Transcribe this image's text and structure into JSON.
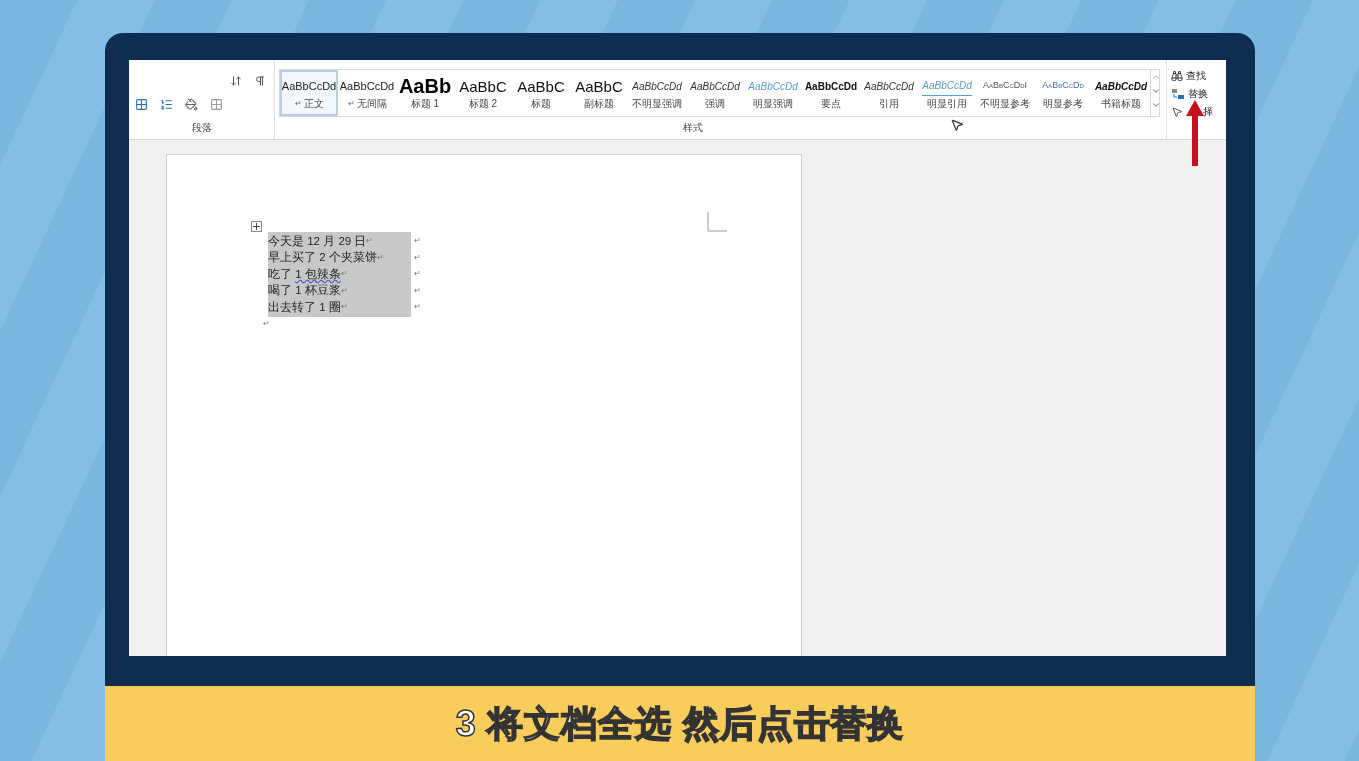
{
  "ribbon": {
    "paragraph_group": {
      "label": "段落"
    },
    "styles_group": {
      "label": "样式",
      "styles": [
        {
          "preview": "AaBbCcDd",
          "label": "正文",
          "kind": "normal",
          "mark": "↵",
          "selected": true
        },
        {
          "preview": "AaBbCcDd",
          "label": "无间隔",
          "kind": "normal",
          "mark": "↵",
          "selected": false
        },
        {
          "preview": "AaBb",
          "label": "标题 1",
          "kind": "heading-large",
          "selected": false
        },
        {
          "preview": "AaBbC",
          "label": "标题 2",
          "kind": "heading",
          "selected": false
        },
        {
          "preview": "AaBbC",
          "label": "标题",
          "kind": "heading",
          "selected": false
        },
        {
          "preview": "AaBbC",
          "label": "副标题",
          "kind": "heading",
          "selected": false
        },
        {
          "preview": "AaBbCcDd",
          "label": "不明显强调",
          "kind": "italic",
          "selected": false
        },
        {
          "preview": "AaBbCcDd",
          "label": "强调",
          "kind": "italic",
          "selected": false
        },
        {
          "preview": "AaBbCcDd",
          "label": "明显强调",
          "kind": "blue-italic",
          "selected": false
        },
        {
          "preview": "AaBbCcDd",
          "label": "要点",
          "kind": "bold",
          "selected": false
        },
        {
          "preview": "AaBbCcDd",
          "label": "引用",
          "kind": "italic",
          "selected": false
        },
        {
          "preview": "AaBbCcDd",
          "label": "明显引用",
          "kind": "quote",
          "selected": false
        },
        {
          "preview": "AaBbCcDdI",
          "label": "不明显参考",
          "kind": "smallcaps",
          "selected": false
        },
        {
          "preview": "AaBbCcDd",
          "label": "明显参考",
          "kind": "smallcaps-blue",
          "selected": false
        },
        {
          "preview": "AaBbCcDd",
          "label": "书籍标题",
          "kind": "bold-italic",
          "selected": false
        }
      ]
    },
    "editing_group": {
      "items": [
        {
          "label": "查找",
          "kind": "find"
        },
        {
          "label": "替换",
          "kind": "replace"
        },
        {
          "label": "择",
          "kind": "select"
        }
      ]
    }
  },
  "document": {
    "lines": [
      {
        "parts": [
          {
            "text": "今天是 12 月 29 日",
            "proofing": false
          }
        ],
        "mark": "↵",
        "cell_mark": "↵"
      },
      {
        "parts": [
          {
            "text": "早上买了 2 个夹菜饼",
            "proofing": false
          }
        ],
        "mark": "↵",
        "cell_mark": "↵"
      },
      {
        "parts": [
          {
            "text": "吃了 ",
            "proofing": false
          },
          {
            "text": "1 包辣条",
            "proofing": true
          }
        ],
        "mark": "↵",
        "cell_mark": "↵"
      },
      {
        "parts": [
          {
            "text": "喝了 1 杯豆浆",
            "proofing": false
          }
        ],
        "mark": "↵",
        "cell_mark": "↵"
      },
      {
        "parts": [
          {
            "text": "出去转了 1 圈",
            "proofing": false
          }
        ],
        "mark": "↵",
        "cell_mark": "↵"
      }
    ],
    "end_mark": "↵"
  },
  "caption": "3 将文档全选 然后点击替换"
}
